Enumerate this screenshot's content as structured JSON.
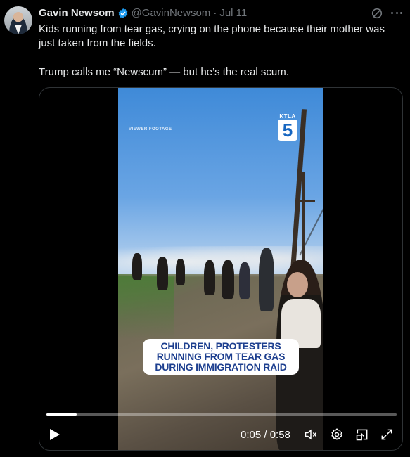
{
  "author": {
    "name": "Gavin Newsom",
    "handle": "@GavinNewsom",
    "separator": "·",
    "date": "Jul 11",
    "avatar_icon": "profile-avatar",
    "verified_icon": "verified-badge-icon",
    "verified_color": "#1d9bf0"
  },
  "tweet": {
    "line1": "Kids running from tear gas, crying on the phone because their mother was just taken from the fields.",
    "line2": "Trump calls me “Newscum” — but he’s the real scum."
  },
  "actions": {
    "grok_icon": "grok-icon",
    "more_icon": "more-options-icon"
  },
  "video": {
    "watermark": "VIEWER FOOTAGE",
    "station_text": "KTLA",
    "station_number": "5",
    "caption_lines": [
      "CHILDREN, PROTESTERS",
      "RUNNING FROM TEAR GAS",
      "DURING IMMIGRATION RAID"
    ],
    "caption_color": "#1d3f8f",
    "progress_fraction": 0.086,
    "time_display": "0:05 / 0:58",
    "controls": [
      "play-icon",
      "volume-icon",
      "settings-icon",
      "picture-in-picture-icon",
      "fullscreen-icon"
    ]
  },
  "colors": {
    "background": "#000000",
    "text": "#e7e9ea",
    "muted": "#71767b",
    "border": "#2f3336"
  }
}
